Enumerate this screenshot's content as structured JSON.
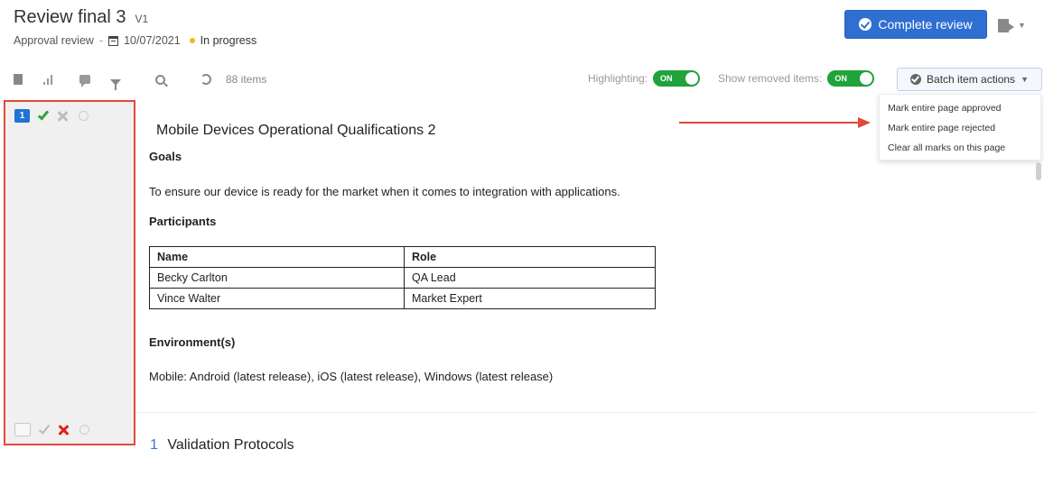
{
  "header": {
    "title": "Review final 3",
    "version": "V1",
    "review_type": "Approval review",
    "separator": "-",
    "date": "10/07/2021",
    "status": "In progress",
    "complete_button": "Complete review",
    "colors": {
      "primary": "#2f6fd1",
      "status_dot": "#f3b81c"
    }
  },
  "toolbar": {
    "items_count": "88 items",
    "highlighting_label": "Highlighting:",
    "highlighting_toggle": "ON",
    "show_removed_label": "Show removed items:",
    "show_removed_toggle": "ON",
    "batch_button": "Batch item actions",
    "icons": [
      "document-icon",
      "chart-icon",
      "comment-icon",
      "filter-icon",
      "search-icon",
      "refresh-icon"
    ]
  },
  "batch_menu": {
    "items": [
      "Mark entire page approved",
      "Mark entire page rejected",
      "Clear all marks on this page"
    ]
  },
  "sidebar": {
    "top_badge": "1"
  },
  "document": {
    "title": "Mobile Devices Operational Qualifications 2",
    "goals_heading": "Goals",
    "goals_text": "To ensure our device is ready for the market when it comes to integration with applications.",
    "participants_heading": "Participants",
    "table": {
      "headers": [
        "Name",
        "Role"
      ],
      "rows": [
        [
          "Becky Carlton",
          "QA Lead"
        ],
        [
          "Vince Walter",
          "Market Expert"
        ]
      ]
    },
    "environment_heading": "Environment(s)",
    "environment_text": "Mobile: Android (latest release), iOS (latest release), Windows (latest release)",
    "section_number": "1",
    "section_title": "Validation Protocols"
  }
}
